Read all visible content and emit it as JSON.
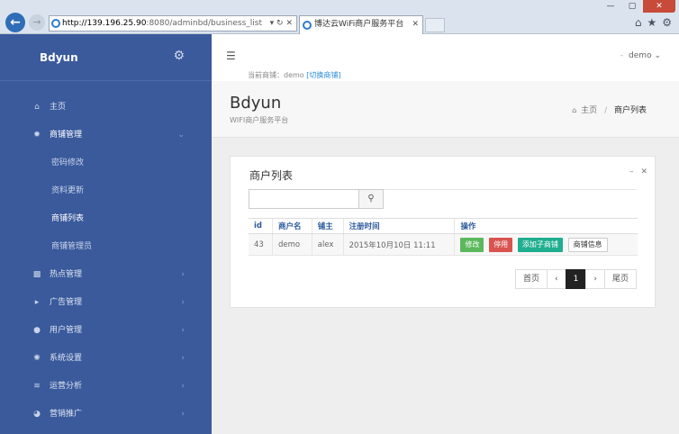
{
  "browser": {
    "url_host": "http://139.196.25.90",
    "url_rest": ":8080/adminbd/business_list",
    "url_controls": "▾ ↻ ✕",
    "tab_title": "博达云WiFi商户服务平台",
    "tab_close": "✕",
    "minimize": "—",
    "maximize": "▢",
    "close": "✕"
  },
  "sidebar": {
    "brand": "Bdyun",
    "items": [
      {
        "label": "主页"
      },
      {
        "label": "商铺管理"
      },
      {
        "label": "密码修改"
      },
      {
        "label": "资料更新"
      },
      {
        "label": "商铺列表"
      },
      {
        "label": "商铺管理员"
      },
      {
        "label": "热点管理"
      },
      {
        "label": "广告管理"
      },
      {
        "label": "用户管理"
      },
      {
        "label": "系统设置"
      },
      {
        "label": "运营分析"
      },
      {
        "label": "营销推广"
      }
    ]
  },
  "topbar": {
    "user": "demo",
    "dash": "-",
    "shop_prefix": "当前商铺：demo",
    "switch_label": "[切换商铺]"
  },
  "pagehead": {
    "title": "Bdyun",
    "subtitle": "WIFI商户服务平台",
    "crumb_home": "主页",
    "crumb_sep": "/",
    "crumb_current": "商户列表"
  },
  "panel": {
    "title": "商户列表",
    "collapse": "–",
    "close": "✕",
    "search_value": "",
    "search_placeholder": ""
  },
  "table": {
    "headers": [
      "id",
      "商户名",
      "铺主",
      "注册时间",
      "操作"
    ],
    "rows": [
      {
        "id": "43",
        "name": "demo",
        "owner": "alex",
        "registered": "2015年10月10日 11:11",
        "actions": [
          "修改",
          "停用",
          "添加子商铺",
          "商铺信息"
        ]
      }
    ]
  },
  "pager": {
    "first": "首页",
    "prev": "‹",
    "current": "1",
    "next": "›",
    "last": "尾页"
  }
}
